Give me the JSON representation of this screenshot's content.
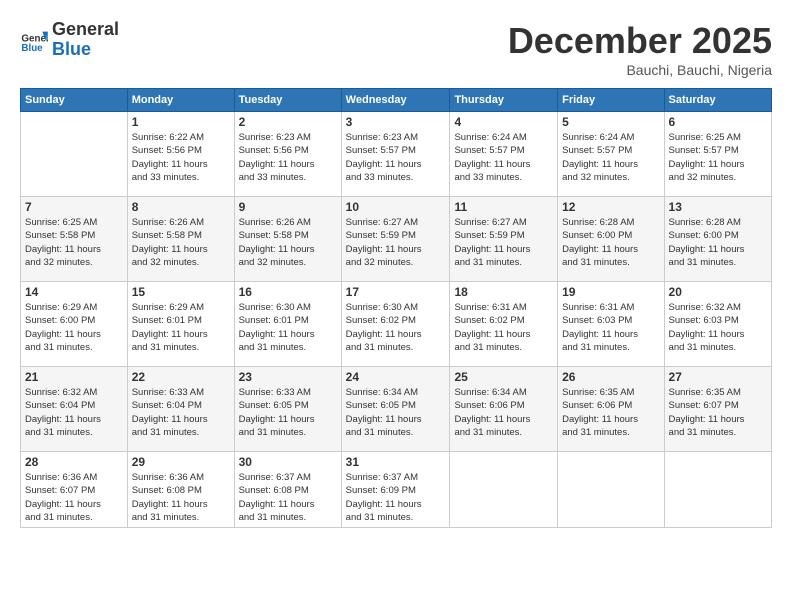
{
  "header": {
    "logo_general": "General",
    "logo_blue": "Blue",
    "month_title": "December 2025",
    "location": "Bauchi, Bauchi, Nigeria"
  },
  "weekdays": [
    "Sunday",
    "Monday",
    "Tuesday",
    "Wednesday",
    "Thursday",
    "Friday",
    "Saturday"
  ],
  "weeks": [
    [
      {
        "day": "",
        "info": ""
      },
      {
        "day": "1",
        "info": "Sunrise: 6:22 AM\nSunset: 5:56 PM\nDaylight: 11 hours\nand 33 minutes."
      },
      {
        "day": "2",
        "info": "Sunrise: 6:23 AM\nSunset: 5:56 PM\nDaylight: 11 hours\nand 33 minutes."
      },
      {
        "day": "3",
        "info": "Sunrise: 6:23 AM\nSunset: 5:57 PM\nDaylight: 11 hours\nand 33 minutes."
      },
      {
        "day": "4",
        "info": "Sunrise: 6:24 AM\nSunset: 5:57 PM\nDaylight: 11 hours\nand 33 minutes."
      },
      {
        "day": "5",
        "info": "Sunrise: 6:24 AM\nSunset: 5:57 PM\nDaylight: 11 hours\nand 32 minutes."
      },
      {
        "day": "6",
        "info": "Sunrise: 6:25 AM\nSunset: 5:57 PM\nDaylight: 11 hours\nand 32 minutes."
      }
    ],
    [
      {
        "day": "7",
        "info": "Sunrise: 6:25 AM\nSunset: 5:58 PM\nDaylight: 11 hours\nand 32 minutes."
      },
      {
        "day": "8",
        "info": "Sunrise: 6:26 AM\nSunset: 5:58 PM\nDaylight: 11 hours\nand 32 minutes."
      },
      {
        "day": "9",
        "info": "Sunrise: 6:26 AM\nSunset: 5:58 PM\nDaylight: 11 hours\nand 32 minutes."
      },
      {
        "day": "10",
        "info": "Sunrise: 6:27 AM\nSunset: 5:59 PM\nDaylight: 11 hours\nand 32 minutes."
      },
      {
        "day": "11",
        "info": "Sunrise: 6:27 AM\nSunset: 5:59 PM\nDaylight: 11 hours\nand 31 minutes."
      },
      {
        "day": "12",
        "info": "Sunrise: 6:28 AM\nSunset: 6:00 PM\nDaylight: 11 hours\nand 31 minutes."
      },
      {
        "day": "13",
        "info": "Sunrise: 6:28 AM\nSunset: 6:00 PM\nDaylight: 11 hours\nand 31 minutes."
      }
    ],
    [
      {
        "day": "14",
        "info": "Sunrise: 6:29 AM\nSunset: 6:00 PM\nDaylight: 11 hours\nand 31 minutes."
      },
      {
        "day": "15",
        "info": "Sunrise: 6:29 AM\nSunset: 6:01 PM\nDaylight: 11 hours\nand 31 minutes."
      },
      {
        "day": "16",
        "info": "Sunrise: 6:30 AM\nSunset: 6:01 PM\nDaylight: 11 hours\nand 31 minutes."
      },
      {
        "day": "17",
        "info": "Sunrise: 6:30 AM\nSunset: 6:02 PM\nDaylight: 11 hours\nand 31 minutes."
      },
      {
        "day": "18",
        "info": "Sunrise: 6:31 AM\nSunset: 6:02 PM\nDaylight: 11 hours\nand 31 minutes."
      },
      {
        "day": "19",
        "info": "Sunrise: 6:31 AM\nSunset: 6:03 PM\nDaylight: 11 hours\nand 31 minutes."
      },
      {
        "day": "20",
        "info": "Sunrise: 6:32 AM\nSunset: 6:03 PM\nDaylight: 11 hours\nand 31 minutes."
      }
    ],
    [
      {
        "day": "21",
        "info": "Sunrise: 6:32 AM\nSunset: 6:04 PM\nDaylight: 11 hours\nand 31 minutes."
      },
      {
        "day": "22",
        "info": "Sunrise: 6:33 AM\nSunset: 6:04 PM\nDaylight: 11 hours\nand 31 minutes."
      },
      {
        "day": "23",
        "info": "Sunrise: 6:33 AM\nSunset: 6:05 PM\nDaylight: 11 hours\nand 31 minutes."
      },
      {
        "day": "24",
        "info": "Sunrise: 6:34 AM\nSunset: 6:05 PM\nDaylight: 11 hours\nand 31 minutes."
      },
      {
        "day": "25",
        "info": "Sunrise: 6:34 AM\nSunset: 6:06 PM\nDaylight: 11 hours\nand 31 minutes."
      },
      {
        "day": "26",
        "info": "Sunrise: 6:35 AM\nSunset: 6:06 PM\nDaylight: 11 hours\nand 31 minutes."
      },
      {
        "day": "27",
        "info": "Sunrise: 6:35 AM\nSunset: 6:07 PM\nDaylight: 11 hours\nand 31 minutes."
      }
    ],
    [
      {
        "day": "28",
        "info": "Sunrise: 6:36 AM\nSunset: 6:07 PM\nDaylight: 11 hours\nand 31 minutes."
      },
      {
        "day": "29",
        "info": "Sunrise: 6:36 AM\nSunset: 6:08 PM\nDaylight: 11 hours\nand 31 minutes."
      },
      {
        "day": "30",
        "info": "Sunrise: 6:37 AM\nSunset: 6:08 PM\nDaylight: 11 hours\nand 31 minutes."
      },
      {
        "day": "31",
        "info": "Sunrise: 6:37 AM\nSunset: 6:09 PM\nDaylight: 11 hours\nand 31 minutes."
      },
      {
        "day": "",
        "info": ""
      },
      {
        "day": "",
        "info": ""
      },
      {
        "day": "",
        "info": ""
      }
    ]
  ]
}
